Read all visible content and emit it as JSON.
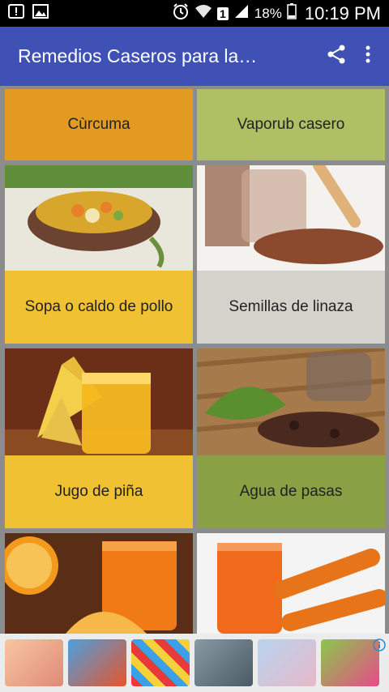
{
  "status_bar": {
    "battery": "18%",
    "time": "10:19 PM",
    "sim": "1",
    "icons": [
      "alert-icon",
      "image-icon",
      "alarm-icon",
      "wifi-icon",
      "signal-icon",
      "battery-icon"
    ]
  },
  "app_bar": {
    "title": "Remedios Caseros para la…",
    "actions": [
      "share-icon",
      "more-vert-icon"
    ],
    "color": "#3f51b5"
  },
  "tiles": [
    {
      "label": "Cùrcuma",
      "color": "#e29a22"
    },
    {
      "label": "Vaporub casero",
      "color": "#afbf63"
    },
    {
      "label": "Sopa o caldo de pollo",
      "color": "#f0c233"
    },
    {
      "label": "Semillas de linaza",
      "color": "#d4d3cb"
    },
    {
      "label": "Jugo de piña",
      "color": "#f0c233"
    },
    {
      "label": "Agua de pasas",
      "color": "#8aa044"
    }
  ],
  "ads": {
    "items": [
      "ad-game-1",
      "ad-game-2",
      "ad-game-3",
      "ad-game-4",
      "ad-game-5",
      "ad-game-6"
    ],
    "info_icon": "info-icon"
  }
}
